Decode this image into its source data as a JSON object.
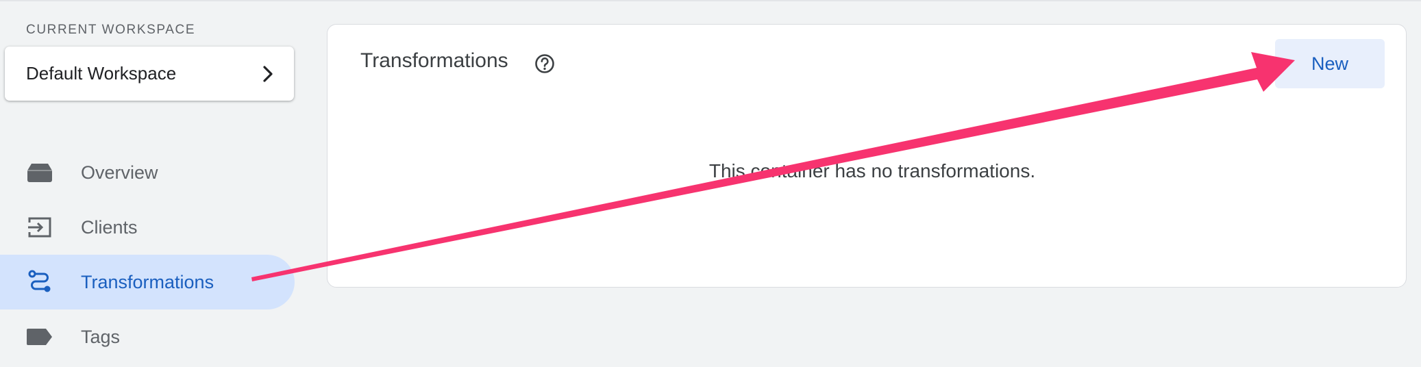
{
  "sidebar": {
    "workspace_label": "CURRENT WORKSPACE",
    "workspace_name": "Default Workspace",
    "items": [
      {
        "label": "Overview",
        "icon": "inbox-icon",
        "active": false
      },
      {
        "label": "Clients",
        "icon": "input-icon",
        "active": false
      },
      {
        "label": "Transformations",
        "icon": "route-icon",
        "active": true
      },
      {
        "label": "Tags",
        "icon": "label-icon",
        "active": false
      }
    ]
  },
  "main": {
    "title": "Transformations",
    "new_button_label": "New",
    "empty_message": "This container has no transformations."
  },
  "colors": {
    "accent": "#1a5fbf",
    "active_nav_bg": "#d3e3fd",
    "annotation_arrow": "#f7336f"
  }
}
